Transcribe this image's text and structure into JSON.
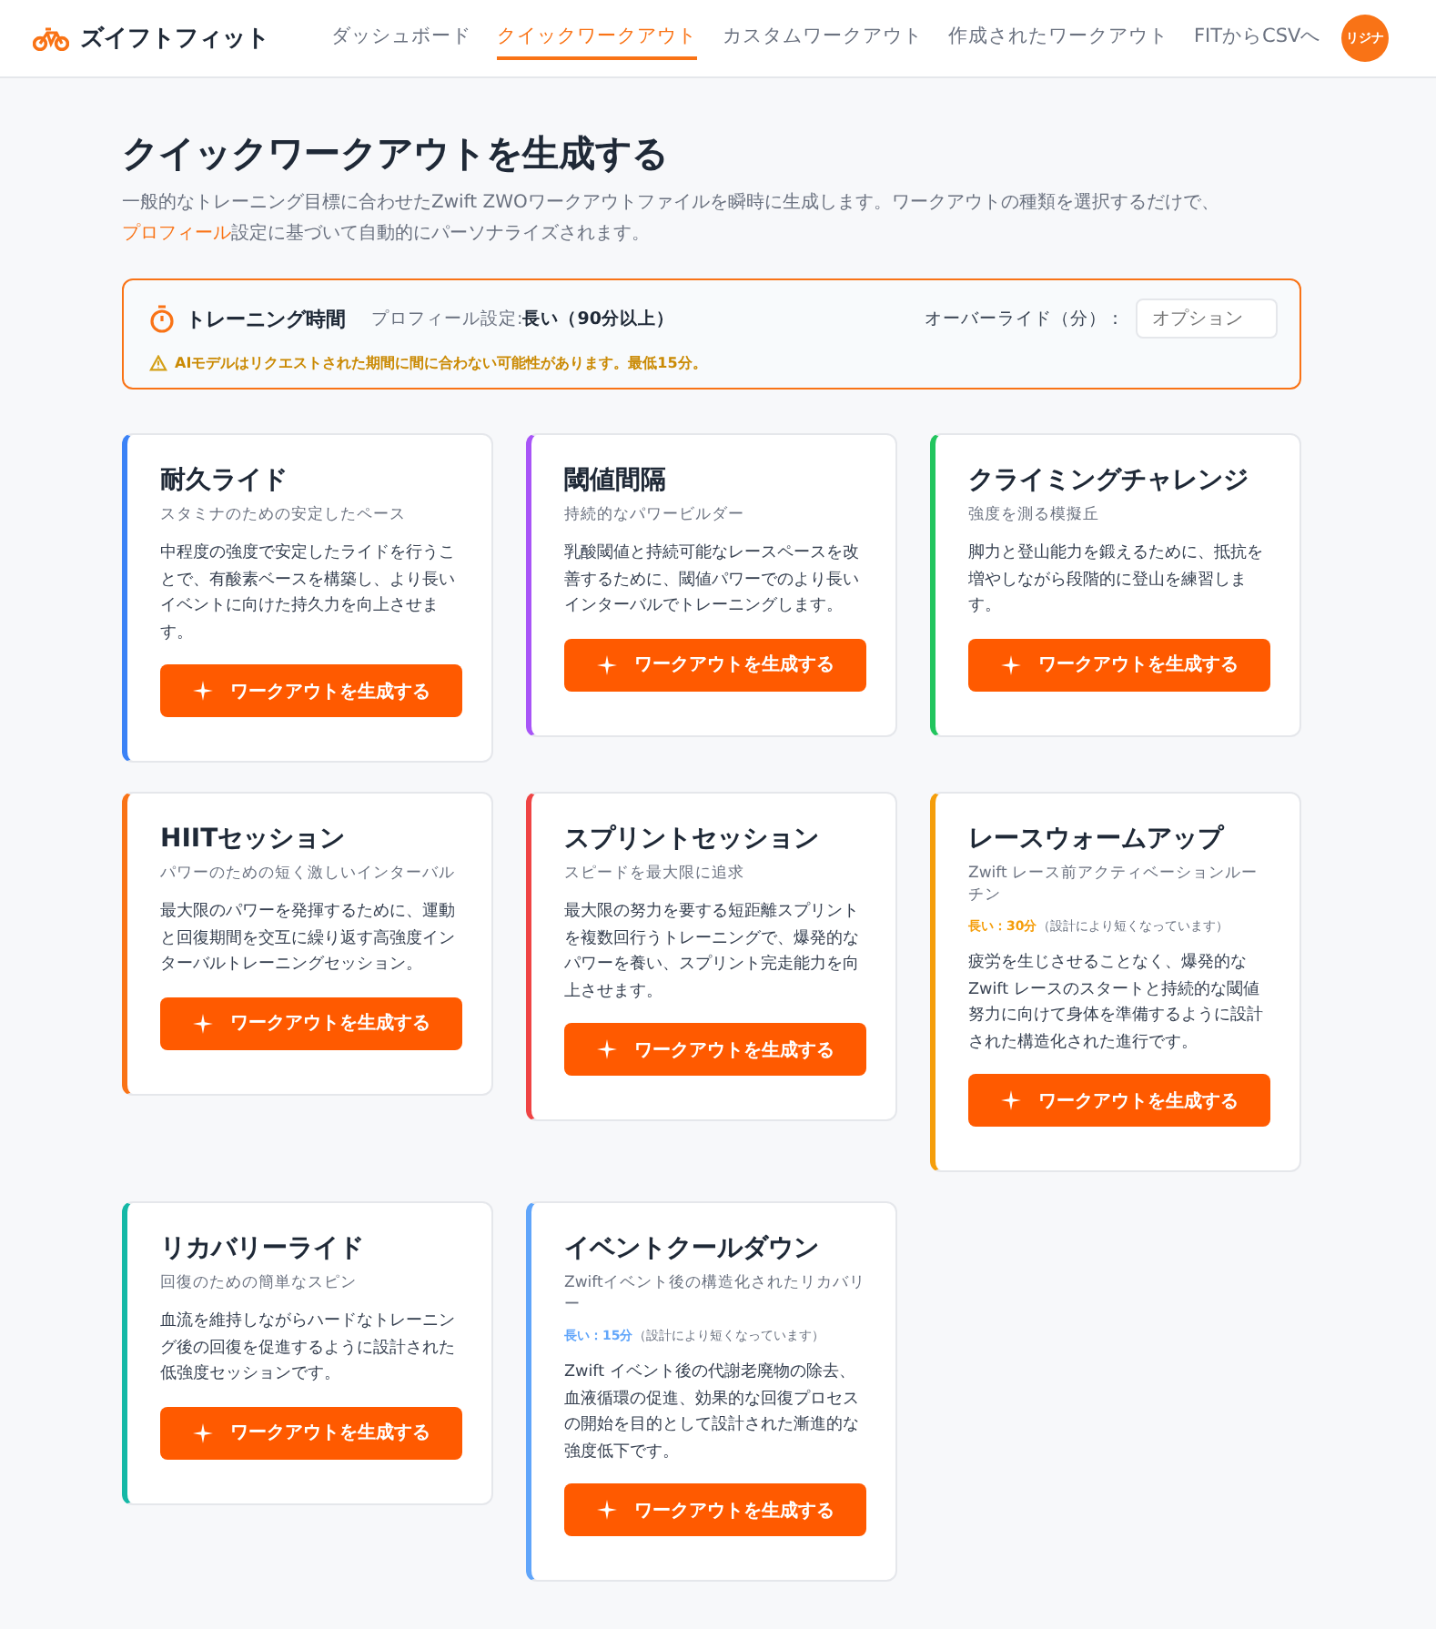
{
  "brand": "ズイフトフィット",
  "nav": [
    {
      "label": "ダッシュボード",
      "selected": false
    },
    {
      "label": "クイックワークアウト",
      "selected": true
    },
    {
      "label": "カスタムワークアウト",
      "selected": false
    },
    {
      "label": "作成されたワークアウト",
      "selected": false
    },
    {
      "label": "FITからCSVへ",
      "selected": false
    }
  ],
  "avatar": "リジナ",
  "title": "クイックワークアウトを生成する",
  "intro": {
    "before": "一般的なトレーニング目標に合わせたZwift ZWOワークアウトファイルを瞬時に生成します。ワークアウトの種類を選択するだけで、",
    "link": "プロフィール",
    "after": "設定に基づいて自動的にパーソナライズされます。"
  },
  "duration_panel": {
    "title": "トレーニング時間",
    "profile_label": "プロフィール設定:",
    "profile_value": "長い（90分以上）",
    "override_label": "オーバーライド（分）：",
    "override_placeholder": "オプション",
    "warning": "AIモデルはリクエストされた期間に間に合わない可能性があります。最低15分。"
  },
  "cards": [
    {
      "title": "耐久ライド",
      "subtitle": "スタミナのための安定したペース",
      "description": "中程度の強度で安定したライドを行うことで、有酸素ベースを構築し、より長いイベントに向けた持久力を向上させます。",
      "button": "ワークアウトを生成する",
      "color": "#3b82f6"
    },
    {
      "title": "閾値間隔",
      "subtitle": "持続的なパワービルダー",
      "description": "乳酸閾値と持続可能なレースペースを改善するために、閾値パワーでのより長いインターバルでトレーニングします。",
      "button": "ワークアウトを生成する",
      "color": "#a855f7"
    },
    {
      "title": "クライミングチャレンジ",
      "subtitle": "強度を測る模擬丘",
      "description": "脚力と登山能力を鍛えるために、抵抗を増やしながら段階的に登山を練習します。",
      "button": "ワークアウトを生成する",
      "color": "#22c55e"
    },
    {
      "title": "HIITセッション",
      "subtitle": "パワーのための短く激しいインターバル",
      "description": "最大限のパワーを発揮するために、運動と回復期間を交互に繰り返す高強度インターバルトレーニングセッション。",
      "button": "ワークアウトを生成する",
      "color": "#f97316"
    },
    {
      "title": "スプリントセッション",
      "subtitle": "スピードを最大限に追求",
      "description": "最大限の努力を要する短距離スプリントを複数回行うトレーニングで、爆発的なパワーを養い、スプリント完走能力を向上させます。",
      "button": "ワークアウトを生成する",
      "color": "#ef4444"
    },
    {
      "title": "レースウォームアップ",
      "subtitle": "Zwift レース前アクティベーションルーチン",
      "note": {
        "value": "長い：30分",
        "hint": "（設計により短くなっています）",
        "color": "#f59e0b"
      },
      "description": "疲労を生じさせることなく、爆発的なZwift レースのスタートと持続的な閾値努力に向けて身体を準備するように設計された構造化された進行です。",
      "button": "ワークアウトを生成する",
      "color": "#f59e0b"
    },
    {
      "title": "リカバリーライド",
      "subtitle": "回復のための簡単なスピン",
      "description": "血流を維持しながらハードなトレーニング後の回復を促進するように設計された低強度セッションです。",
      "button": "ワークアウトを生成する",
      "color": "#14b8a6"
    },
    {
      "title": "イベントクールダウン",
      "subtitle": "Zwiftイベント後の構造化されたリカバリー",
      "note": {
        "value": "長い：15分",
        "hint": "（設計により短くなっています）",
        "color": "#60a5fa"
      },
      "description": "Zwift イベント後の代謝老廃物の除去、血液循環の促進、効果的な回復プロセスの開始を目的として設計された漸進的な強度低下です。",
      "button": "ワークアウトを生成する",
      "color": "#60a5fa"
    }
  ]
}
